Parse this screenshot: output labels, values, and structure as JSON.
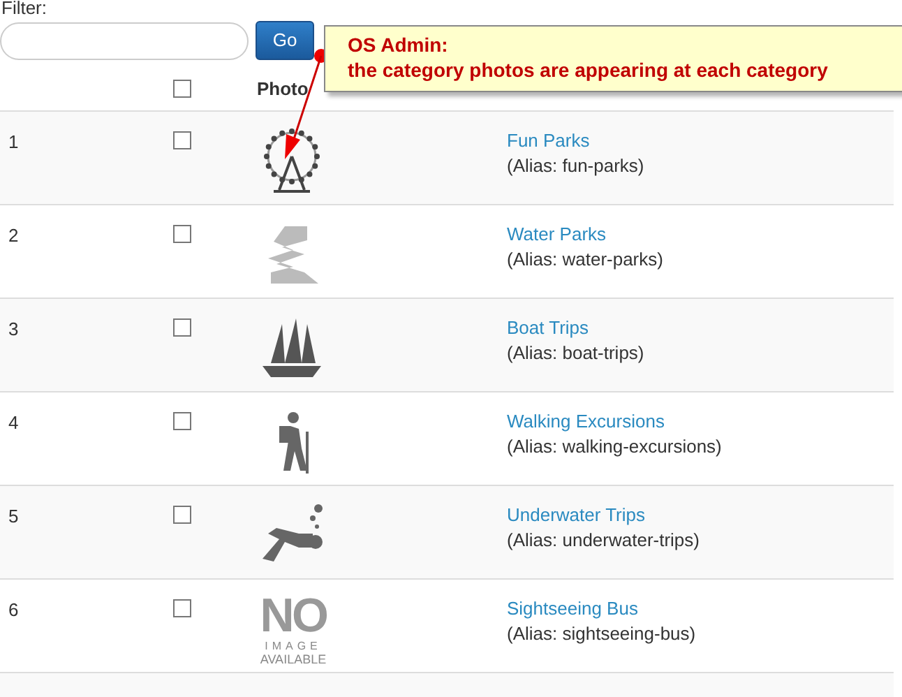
{
  "filter": {
    "label": "Filter:",
    "button": "Go"
  },
  "callout": {
    "title": "OS Admin:",
    "text": "the category photos are appearing at each category"
  },
  "table": {
    "header": {
      "checked": false,
      "photo_label": "Photo"
    },
    "rows": [
      {
        "number": "1",
        "checked": false,
        "photo": {
          "kind": "ferris_wheel"
        },
        "name": "Fun Parks",
        "alias": "(Alias: fun-parks)"
      },
      {
        "number": "2",
        "checked": false,
        "photo": {
          "kind": "slide"
        },
        "name": "Water Parks",
        "alias": "(Alias: water-parks)"
      },
      {
        "number": "3",
        "checked": false,
        "photo": {
          "kind": "ship"
        },
        "name": "Boat Trips",
        "alias": "(Alias: boat-trips)"
      },
      {
        "number": "4",
        "checked": false,
        "photo": {
          "kind": "hiker"
        },
        "name": "Walking Excursions",
        "alias": "(Alias: walking-excursions)"
      },
      {
        "number": "5",
        "checked": false,
        "photo": {
          "kind": "diver"
        },
        "name": "Underwater Trips",
        "alias": "(Alias: underwater-trips)"
      },
      {
        "number": "6",
        "checked": false,
        "photo": {
          "kind": "no_image",
          "lines": [
            "NO",
            "IMAGE",
            "AVAILABLE"
          ]
        },
        "name": "Sightseeing Bus",
        "alias": "(Alias: sightseeing-bus)"
      }
    ]
  }
}
